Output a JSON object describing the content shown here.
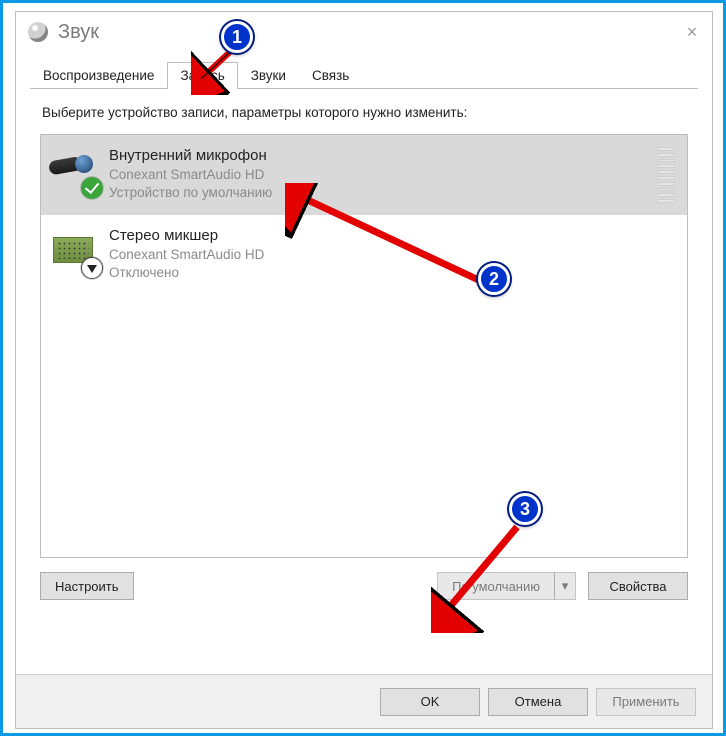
{
  "window": {
    "title": "Звук",
    "close": "×"
  },
  "tabs": {
    "playback": "Воспроизведение",
    "recording": "Запись",
    "sounds": "Звуки",
    "communications": "Связь"
  },
  "instruction": "Выберите устройство записи, параметры которого нужно изменить:",
  "devices": [
    {
      "title": "Внутренний микрофон",
      "desc": "Conexant SmartAudio HD",
      "status": "Устройство по умолчанию"
    },
    {
      "title": "Стерео микшер",
      "desc": "Conexant SmartAudio HD",
      "status": "Отключено"
    }
  ],
  "buttons": {
    "configure": "Настроить",
    "set_default": "По умолчанию",
    "dropdown_caret": "▾",
    "properties": "Свойства",
    "ok": "OK",
    "cancel": "Отмена",
    "apply": "Применить"
  },
  "callouts": {
    "c1": "1",
    "c2": "2",
    "c3": "3"
  }
}
